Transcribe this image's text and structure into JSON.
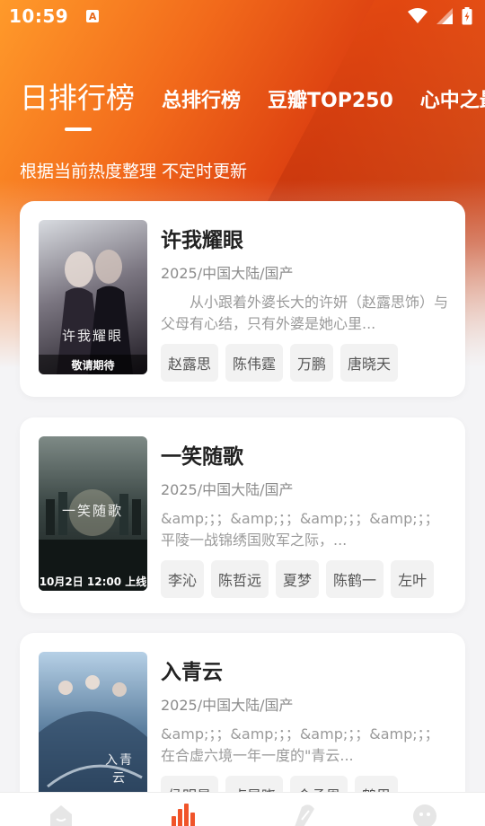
{
  "status_bar": {
    "time": "10:59",
    "notification_icon_letter": "A",
    "icons": [
      "wifi-icon",
      "signal-icon",
      "battery-icon"
    ]
  },
  "tabs": [
    {
      "label": "日排行榜",
      "active": true
    },
    {
      "label": "总排行榜",
      "active": false
    },
    {
      "label": "豆瓣TOP250",
      "active": false
    },
    {
      "label": "心中之最",
      "active": false
    }
  ],
  "subtitle": "根据当前热度整理 不定时更新",
  "items": [
    {
      "title": "许我耀眼",
      "meta": "2025/中国大陆/国产",
      "description": "从小跟着外婆长大的许妍（赵露思饰）与父母有心结，只有外婆是她心里...",
      "cast": [
        "赵露思",
        "陈伟霆",
        "万鹏",
        "唐晓天"
      ],
      "poster_title": "许我耀眼",
      "poster_caption": "敬请期待",
      "poster_colors": [
        "#c9cdd3",
        "#6e6a72",
        "#1e1a22"
      ]
    },
    {
      "title": "一笑随歌",
      "meta": "2025/中国大陆/国产",
      "description": "&amp;；；&amp;；；&amp;；；&amp;；；平陵一战锦绣国败军之际，...",
      "cast": [
        "李沁",
        "陈哲远",
        "夏梦",
        "陈鹤一",
        "左叶"
      ],
      "poster_title": "一笑随歌",
      "poster_caption": "10月2日 12:00 上线",
      "poster_colors": [
        "#5b6a66",
        "#2d3836",
        "#161c1b"
      ]
    },
    {
      "title": "入青云",
      "meta": "2025/中国大陆/国产",
      "description": "&amp;；；&amp;；；&amp;；；&amp;；；在合虚六境一年一度的\"青云...",
      "cast": [
        "侯明昊",
        "卢昱晓",
        "金承恩",
        "鹤里"
      ],
      "poster_title": "入青云",
      "poster_caption": "",
      "poster_colors": [
        "#a8c6de",
        "#4e6f8d",
        "#243a52"
      ]
    }
  ],
  "bottom_nav": [
    {
      "icon": "home-icon",
      "active": false
    },
    {
      "icon": "ranking-icon",
      "active": true
    },
    {
      "icon": "discover-icon",
      "active": false
    },
    {
      "icon": "profile-icon",
      "active": false
    }
  ],
  "colors": {
    "accent": "#f0542a",
    "hero_orange": "#f26a1b",
    "hero_red": "#c1320c"
  }
}
